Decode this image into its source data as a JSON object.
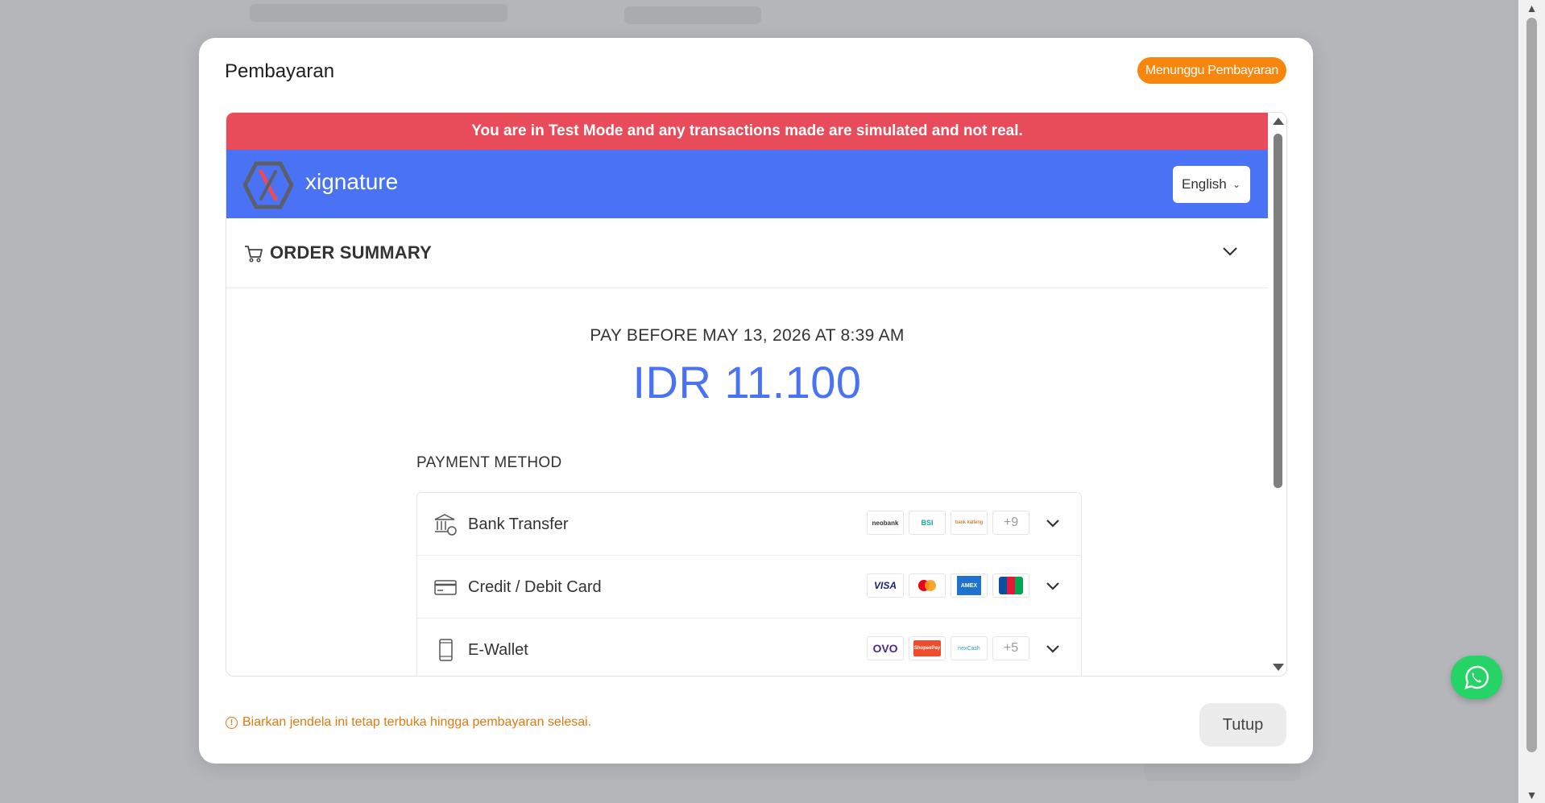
{
  "modal": {
    "title": "Pembayaran",
    "status_badge": "Menunggu Pembayaran",
    "notice": "Biarkan jendela ini tetap terbuka hingga pembayaran selesai.",
    "close_label": "Tutup"
  },
  "payment_page": {
    "test_banner": "You are in Test Mode and any transactions made are simulated and not real.",
    "brand_name": "xignature",
    "language": "English",
    "order_summary_label": "ORDER SUMMARY",
    "pay_before": "PAY BEFORE MAY 13, 2026 AT 8:39 AM",
    "amount": "IDR 11.100",
    "payment_method_label": "PAYMENT METHOD",
    "methods": [
      {
        "label": "Bank Transfer",
        "logos": [
          "neobank",
          "BSI",
          "bank kalteng"
        ],
        "more": "+9",
        "icon": "bank-icon"
      },
      {
        "label": "Credit / Debit Card",
        "logos": [
          "VISA",
          "mastercard",
          "AMEX",
          "JCB"
        ],
        "more": "",
        "icon": "credit-card-icon"
      },
      {
        "label": "E-Wallet",
        "logos": [
          "OVO",
          "ShopeePay",
          "nexCash"
        ],
        "more": "+5",
        "icon": "phone-icon"
      }
    ]
  },
  "colors": {
    "accent_blue": "#4a72f5",
    "test_banner_red": "#e84c5a",
    "status_orange": "#f7860f",
    "whatsapp_green": "#25d366"
  }
}
